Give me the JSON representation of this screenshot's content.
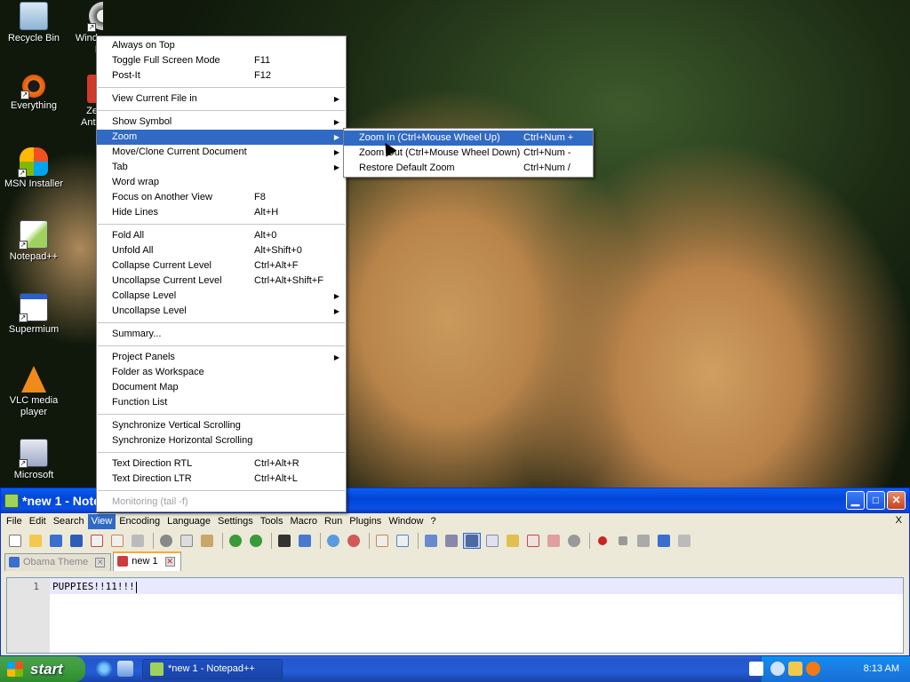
{
  "desktop": {
    "icons": [
      {
        "label": "Recycle Bin",
        "icon": "recycle-bin-icon"
      },
      {
        "label": "Windo\nM",
        "icon": "windows-movie-maker-icon"
      },
      {
        "label": "Everything",
        "icon": "everything-search-icon"
      },
      {
        "label": "Ze\nAnti",
        "icon": "zemana-antilogger-icon"
      },
      {
        "label": "MSN Installer",
        "icon": "msn-butterfly-icon"
      },
      {
        "label": "Notepad++",
        "icon": "notepadpp-icon"
      },
      {
        "label": "Supermium",
        "icon": "supermium-icon"
      },
      {
        "label": "VLC media player",
        "icon": "vlc-cone-icon"
      },
      {
        "label": "Microsoft",
        "icon": "microsoft-app-icon"
      }
    ]
  },
  "view_menu": {
    "items": [
      {
        "label": "Always on Top",
        "shortcut": ""
      },
      {
        "label": "Toggle Full Screen Mode",
        "shortcut": "F11"
      },
      {
        "label": "Post-It",
        "shortcut": "F12"
      },
      {
        "label": "View Current File in",
        "shortcut": ""
      },
      {
        "label": "Show Symbol",
        "shortcut": ""
      },
      {
        "label": "Zoom",
        "shortcut": ""
      },
      {
        "label": "Move/Clone Current Document",
        "shortcut": ""
      },
      {
        "label": "Tab",
        "shortcut": ""
      },
      {
        "label": "Word wrap",
        "shortcut": ""
      },
      {
        "label": "Focus on Another View",
        "shortcut": "F8"
      },
      {
        "label": "Hide Lines",
        "shortcut": "Alt+H"
      },
      {
        "label": "Fold All",
        "shortcut": "Alt+0"
      },
      {
        "label": "Unfold All",
        "shortcut": "Alt+Shift+0"
      },
      {
        "label": "Collapse Current Level",
        "shortcut": "Ctrl+Alt+F"
      },
      {
        "label": "Uncollapse Current Level",
        "shortcut": "Ctrl+Alt+Shift+F"
      },
      {
        "label": "Collapse Level",
        "shortcut": ""
      },
      {
        "label": "Uncollapse Level",
        "shortcut": ""
      },
      {
        "label": "Summary...",
        "shortcut": ""
      },
      {
        "label": "Project Panels",
        "shortcut": ""
      },
      {
        "label": "Folder as Workspace",
        "shortcut": ""
      },
      {
        "label": "Document Map",
        "shortcut": ""
      },
      {
        "label": "Function List",
        "shortcut": ""
      },
      {
        "label": "Synchronize Vertical Scrolling",
        "shortcut": ""
      },
      {
        "label": "Synchronize Horizontal Scrolling",
        "shortcut": ""
      },
      {
        "label": "Text Direction RTL",
        "shortcut": "Ctrl+Alt+R"
      },
      {
        "label": "Text Direction LTR",
        "shortcut": "Ctrl+Alt+L"
      },
      {
        "label": "Monitoring (tail -f)",
        "shortcut": ""
      }
    ]
  },
  "zoom_submenu": {
    "items": [
      {
        "label": "Zoom In (Ctrl+Mouse Wheel Up)",
        "shortcut": "Ctrl+Num +"
      },
      {
        "label": "Zoom Out (Ctrl+Mouse Wheel Down)",
        "shortcut": "Ctrl+Num -"
      },
      {
        "label": "Restore Default Zoom",
        "shortcut": "Ctrl+Num /"
      }
    ]
  },
  "window": {
    "title": "*new 1 - Note",
    "close_x": "X",
    "menubar": [
      "File",
      "Edit",
      "Search",
      "View",
      "Encoding",
      "Language",
      "Settings",
      "Tools",
      "Macro",
      "Run",
      "Plugins",
      "Window",
      "?"
    ],
    "tabs": [
      {
        "label": "Obama Theme",
        "close": "✕"
      },
      {
        "label": "new 1",
        "close": "✕"
      }
    ],
    "editor": {
      "line_number": "1",
      "text": "PUPPIES!!11!!!"
    }
  },
  "taskbar": {
    "start_label": "start",
    "task_button": "*new 1 - Notepad++",
    "clock": "8:13 AM"
  },
  "colors": {
    "menu_highlight": "#316ac5",
    "taskbar_blue": "#245dd7",
    "start_green": "#3c9c3c",
    "title_blue": "#0245d8"
  }
}
